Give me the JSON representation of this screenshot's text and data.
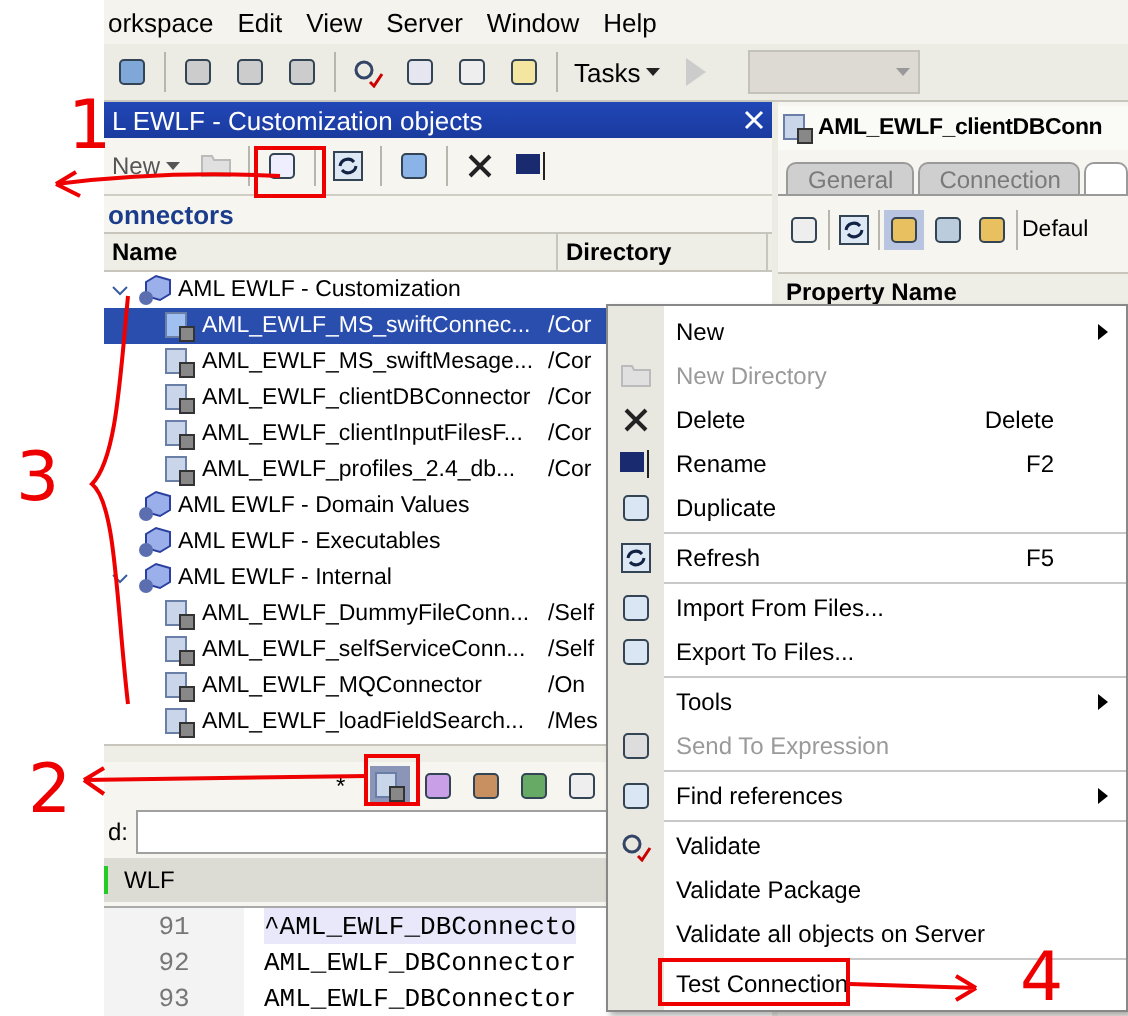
{
  "menu_bar": [
    "orkspace",
    "Edit",
    "View",
    "Server",
    "Window",
    "Help"
  ],
  "toolbar": {
    "tasks_label": "Tasks"
  },
  "left_panel": {
    "title": "L EWLF - Customization objects",
    "new_label": "New",
    "section": "onnectors",
    "columns": [
      "Name",
      "Directory"
    ],
    "tree": [
      {
        "label": "AML EWLF - Customization",
        "expanded": true,
        "children": [
          {
            "label": "AML_EWLF_MS_swiftConnec...",
            "directory": "/Cor",
            "selected": true
          },
          {
            "label": "AML_EWLF_MS_swiftMesage...",
            "directory": "/Cor",
            "selected": false
          },
          {
            "label": "AML_EWLF_clientDBConnector",
            "directory": "/Cor",
            "selected": false
          },
          {
            "label": "AML_EWLF_clientInputFilesF...",
            "directory": "/Cor",
            "selected": false
          },
          {
            "label": "AML_EWLF_profiles_2.4_db...",
            "directory": "/Cor",
            "selected": false
          }
        ]
      },
      {
        "label": "AML EWLF - Domain Values",
        "expanded": false
      },
      {
        "label": "AML EWLF - Executables",
        "expanded": false
      },
      {
        "label": "AML EWLF - Internal",
        "expanded": true,
        "children": [
          {
            "label": "AML_EWLF_DummyFileConn...",
            "directory": "/Self",
            "selected": false
          },
          {
            "label": "AML_EWLF_selfServiceConn...",
            "directory": "/Self",
            "selected": false
          },
          {
            "label": "AML_EWLF_MQConnector",
            "directory": "/On",
            "selected": false
          },
          {
            "label": "AML_EWLF_loadFieldSearch...",
            "directory": "/Mes",
            "selected": false
          }
        ]
      }
    ],
    "bottom_toolbar_star": "*",
    "field_label": "d:",
    "tab": "WLF",
    "code_lines": [
      {
        "number": "91",
        "text": "^AML_EWLF_DBConnecto",
        "highlighted": true
      },
      {
        "number": "92",
        "text": "AML_EWLF_DBConnector",
        "highlighted": false
      },
      {
        "number": "93",
        "text": "AML_EWLF_DBConnector",
        "highlighted": false
      }
    ]
  },
  "right_panel": {
    "title": "AML_EWLF_clientDBConn",
    "tabs": [
      {
        "label": "General",
        "selected": false
      },
      {
        "label": "Connection",
        "selected": false
      },
      {
        "selected": true
      }
    ],
    "view_label": "Defaul",
    "header": "Property Name"
  },
  "context_menu": [
    {
      "kind": "item",
      "label": "New",
      "submenu": true,
      "disabled": false
    },
    {
      "kind": "item",
      "label": "New Directory",
      "disabled": true
    },
    {
      "kind": "item",
      "label": "Delete",
      "shortcut": "Delete",
      "disabled": false
    },
    {
      "kind": "item",
      "label": "Rename",
      "shortcut": "F2",
      "disabled": false
    },
    {
      "kind": "item",
      "label": "Duplicate",
      "disabled": false
    },
    {
      "kind": "separator"
    },
    {
      "kind": "item",
      "label": "Refresh",
      "shortcut": "F5",
      "disabled": false
    },
    {
      "kind": "separator"
    },
    {
      "kind": "item",
      "label": "Import From Files...",
      "disabled": false
    },
    {
      "kind": "item",
      "label": "Export To Files...",
      "disabled": false
    },
    {
      "kind": "separator"
    },
    {
      "kind": "item",
      "label": "Tools",
      "submenu": true,
      "disabled": false
    },
    {
      "kind": "item",
      "label": "Send To Expression",
      "disabled": true
    },
    {
      "kind": "separator"
    },
    {
      "kind": "item",
      "label": "Find references",
      "submenu": true,
      "disabled": false
    },
    {
      "kind": "separator"
    },
    {
      "kind": "item",
      "label": "Validate",
      "disabled": false
    },
    {
      "kind": "item",
      "label": "Validate Package",
      "disabled": false
    },
    {
      "kind": "item",
      "label": "Validate all objects on Server",
      "disabled": false
    },
    {
      "kind": "separator"
    },
    {
      "kind": "item",
      "label": "Test Connection",
      "disabled": false
    }
  ],
  "annotations": [
    "1",
    "2",
    "3",
    "4"
  ]
}
